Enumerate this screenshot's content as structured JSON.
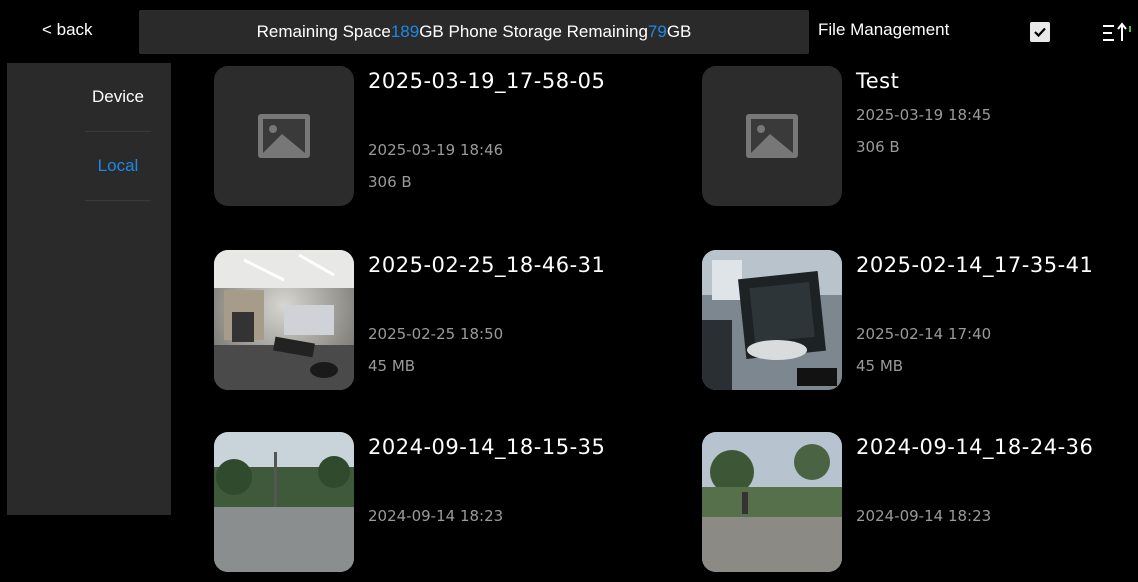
{
  "header": {
    "back_label": "< back",
    "storage": {
      "remaining_label": "Remaining Space",
      "remaining_value": "189",
      "unit1": "GB",
      "phone_label": "Phone Storage Remaining",
      "phone_value": "79",
      "unit2": "GB"
    },
    "file_management_label": "File Management",
    "select_all_checked": true
  },
  "sidebar": {
    "items": [
      {
        "label": "Device",
        "active": false
      },
      {
        "label": "Local",
        "active": true
      }
    ]
  },
  "files": [
    {
      "name": "2025-03-19_17-58-05",
      "date": "2025-03-19 18:46",
      "size": "306 B",
      "thumb": "placeholder"
    },
    {
      "name": "Test",
      "date": "2025-03-19 18:45",
      "size": "306 B",
      "thumb": "placeholder"
    },
    {
      "name": "2025-02-25_18-46-31",
      "date": "2025-02-25 18:50",
      "size": "45 MB",
      "thumb": "office-photo"
    },
    {
      "name": "2025-02-14_17-35-41",
      "date": "2025-02-14 17:40",
      "size": "45 MB",
      "thumb": "case-photo"
    },
    {
      "name": "2024-09-14_18-15-35",
      "date": "2024-09-14 18:23",
      "size": "",
      "thumb": "outdoor-photo"
    },
    {
      "name": "2024-09-14_18-24-36",
      "date": "2024-09-14 18:23",
      "size": "",
      "thumb": "outdoor-photo-2"
    }
  ],
  "colors": {
    "accent": "#1e88e5",
    "panel": "#2a2a2a",
    "muted_text": "#9a9a9a"
  }
}
